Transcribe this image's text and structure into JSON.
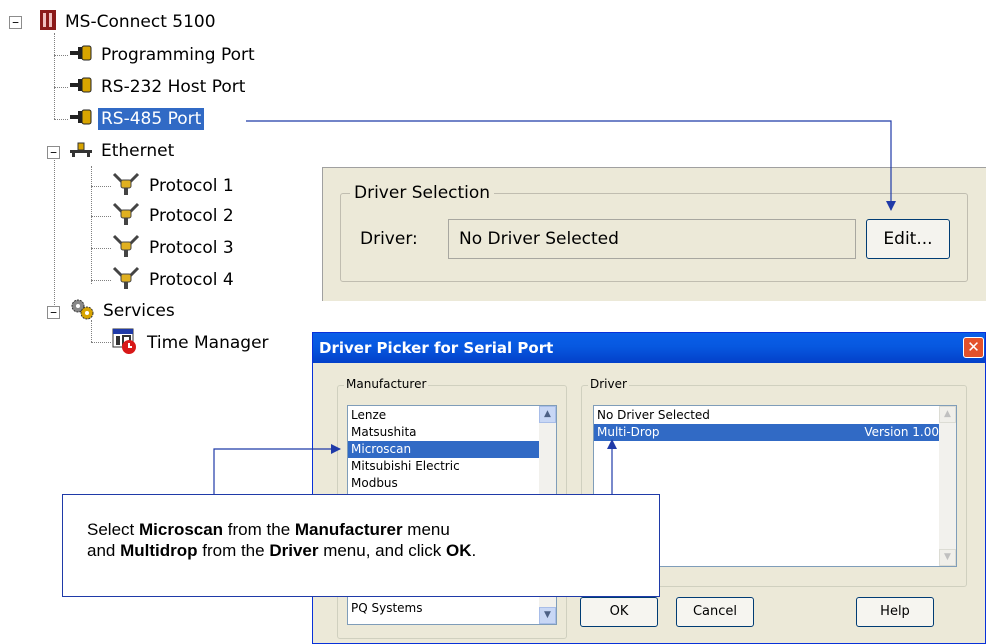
{
  "tree": {
    "root": "MS-Connect 5100",
    "programming_port": "Programming Port",
    "rs232": "RS-232 Host Port",
    "rs485": "RS-485 Port",
    "ethernet": "Ethernet",
    "protocols": [
      "Protocol 1",
      "Protocol 2",
      "Protocol 3",
      "Protocol 4"
    ],
    "services": "Services",
    "time_manager": "Time Manager",
    "expander_symbol": "−"
  },
  "driver_selection": {
    "group_title": "Driver Selection",
    "driver_label": "Driver:",
    "driver_value": "No Driver Selected",
    "edit_button": "Edit..."
  },
  "dialog": {
    "title": "Driver Picker for Serial Port",
    "close_symbol": "✕",
    "manufacturer_label": "Manufacturer",
    "driver_label": "Driver",
    "manufacturers": [
      "Lenze",
      "Matsushita",
      "Microscan",
      "Mitsubishi Electric",
      "Modbus"
    ],
    "manufacturer_last": "PQ Systems",
    "drivers": [
      {
        "name": "No Driver Selected",
        "version": ""
      },
      {
        "name": "Multi-Drop",
        "version": "Version 1.00"
      }
    ],
    "ok_button": "OK",
    "cancel_button": "Cancel",
    "help_button": "Help"
  },
  "callout": {
    "t1": "Select ",
    "b1": "Microscan",
    "t2": " from the ",
    "b2": "Manufacturer",
    "t3": " menu",
    "t4": "and ",
    "b3": "Multidrop",
    "t5": " from the ",
    "b4": "Driver",
    "t6": " menu, and click ",
    "b5": "OK",
    "t7": "."
  },
  "colors": {
    "selection": "#316ac5",
    "dialog_face": "#ece9d8",
    "title_bar": "#0a5fe8",
    "close_button": "#e4512b",
    "arrow": "#1f3aa8"
  }
}
